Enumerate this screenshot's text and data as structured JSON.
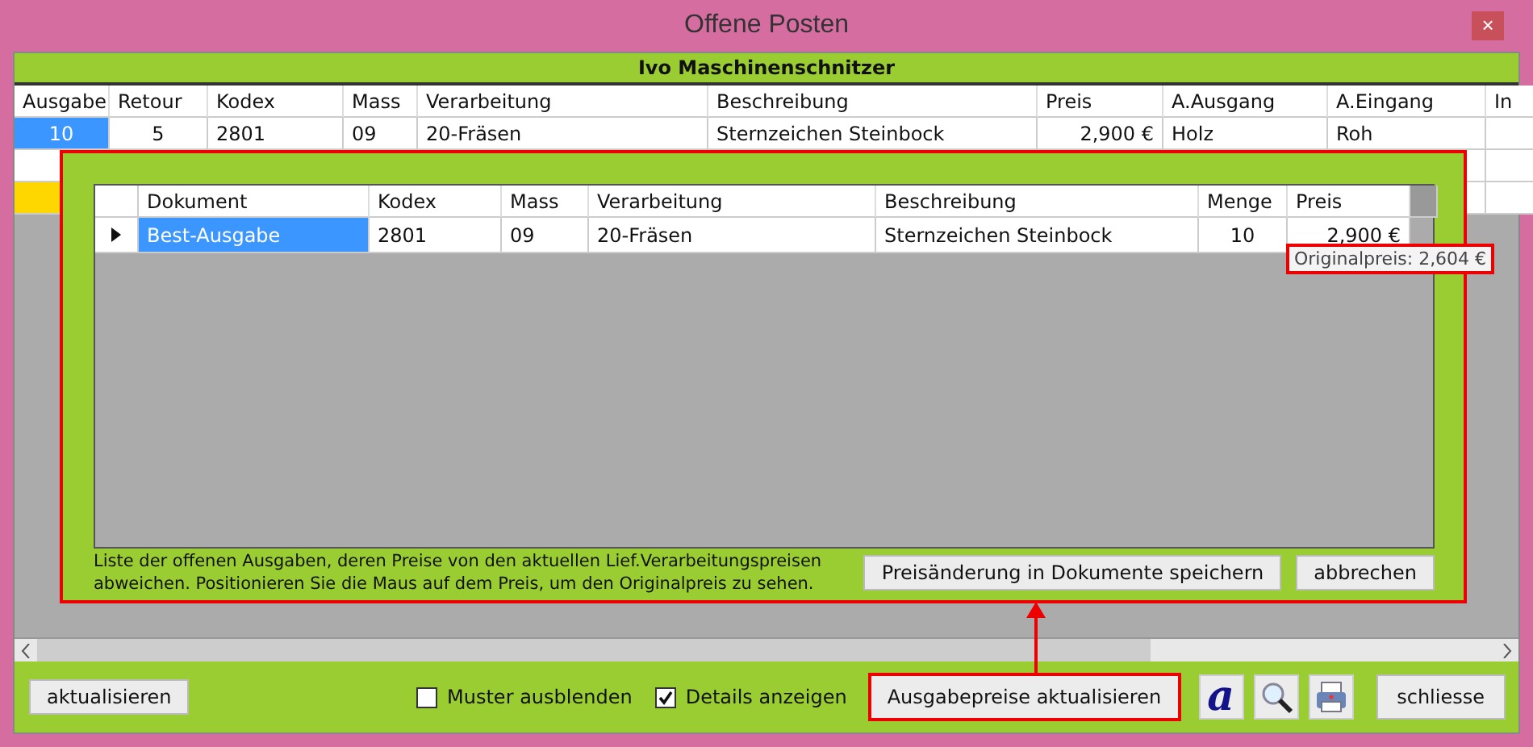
{
  "window": {
    "title": "Offene Posten",
    "close": "×"
  },
  "header": {
    "title": "Ivo Maschinenschnitzer"
  },
  "table": {
    "columns": [
      "Ausgabe",
      "Retour",
      "Kodex",
      "Mass",
      "Verarbeitung",
      "Beschreibung",
      "Preis",
      "A.Ausgang",
      "A.Eingang",
      "In"
    ],
    "rows": [
      {
        "selected": true,
        "cells": [
          "10",
          "5",
          "2801",
          "09",
          "20-Fräsen",
          "Sternzeichen Steinbock",
          "2,900 €",
          "Holz",
          "Roh"
        ]
      },
      {
        "selected": false
      },
      {
        "selected": false,
        "marked": true
      }
    ]
  },
  "dialog": {
    "columns": [
      "Dokument",
      "Kodex",
      "Mass",
      "Verarbeitung",
      "Beschreibung",
      "Menge",
      "Preis"
    ],
    "rows": [
      {
        "selected": true,
        "current": true,
        "cells": [
          "Best-Ausgabe",
          "2801",
          "09",
          "20-Fräsen",
          "Sternzeichen Steinbock",
          "10",
          "2,900 €"
        ]
      }
    ],
    "tooltip": "Originalpreis: 2,604 €",
    "note": "Liste der offenen Ausgaben, deren Preise von den aktuellen Lief.Verarbeitungspreisen abweichen. Positionieren Sie die Maus auf dem Preis, um den Originalpreis zu sehen.",
    "buttons": [
      "Preisänderung in Dokumente speichern",
      "abbrechen"
    ]
  },
  "footer": {
    "refresh": "aktualisieren",
    "checkboxes": [
      {
        "label": "Muster ausblenden",
        "checked": false
      },
      {
        "label": "Details anzeigen",
        "checked": true
      }
    ],
    "update": "Ausgabepreise aktualisieren",
    "font_button": "a",
    "close": "schliesse"
  }
}
